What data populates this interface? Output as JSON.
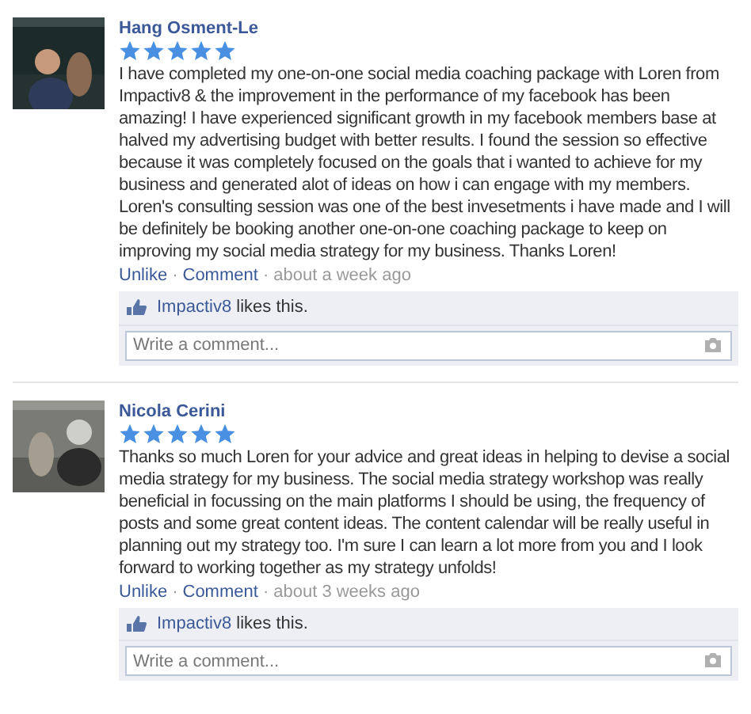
{
  "reviews": [
    {
      "author": "Hang Osment-Le",
      "stars": 5,
      "text": "I have completed my one-on-one social media coaching package with Loren from Impactiv8 & the improvement in the performance of my facebook has been amazing! I have experienced significant growth in my facebook members base at halved my advertising budget with better results. I found the session so effective because it was completely focused on the goals that i wanted to achieve for my business and generated alot of ideas on how i can engage with my members. Loren's consulting session was one of the best invesetments i have made and I will be definitely be booking another one-on-one coaching package to keep on improving my social media strategy for my business. Thanks Loren!",
      "actions": [
        "Unlike",
        "Comment"
      ],
      "separator": "·",
      "time": "about a week ago",
      "likes": {
        "by": "Impactiv8",
        "suffix": "likes this."
      },
      "comment": {
        "placeholder": "Write a comment..."
      }
    },
    {
      "author": "Nicola Cerini",
      "stars": 5,
      "text": "Thanks so much Loren for your advice and great ideas in helping to devise a social media strategy for my business. The social media strategy workshop was really beneficial in focussing on the main platforms I should be using, the frequency of posts and some great content ideas. The content calendar will be really useful in planning out my strategy too. I'm sure I can learn a lot more from you and I look forward to working together as my strategy unfolds!",
      "actions": [
        "Unlike",
        "Comment"
      ],
      "separator": "·",
      "time": "about 3 weeks ago",
      "likes": {
        "by": "Impactiv8",
        "suffix": "likes this."
      },
      "comment": {
        "placeholder": "Write a comment..."
      }
    }
  ]
}
